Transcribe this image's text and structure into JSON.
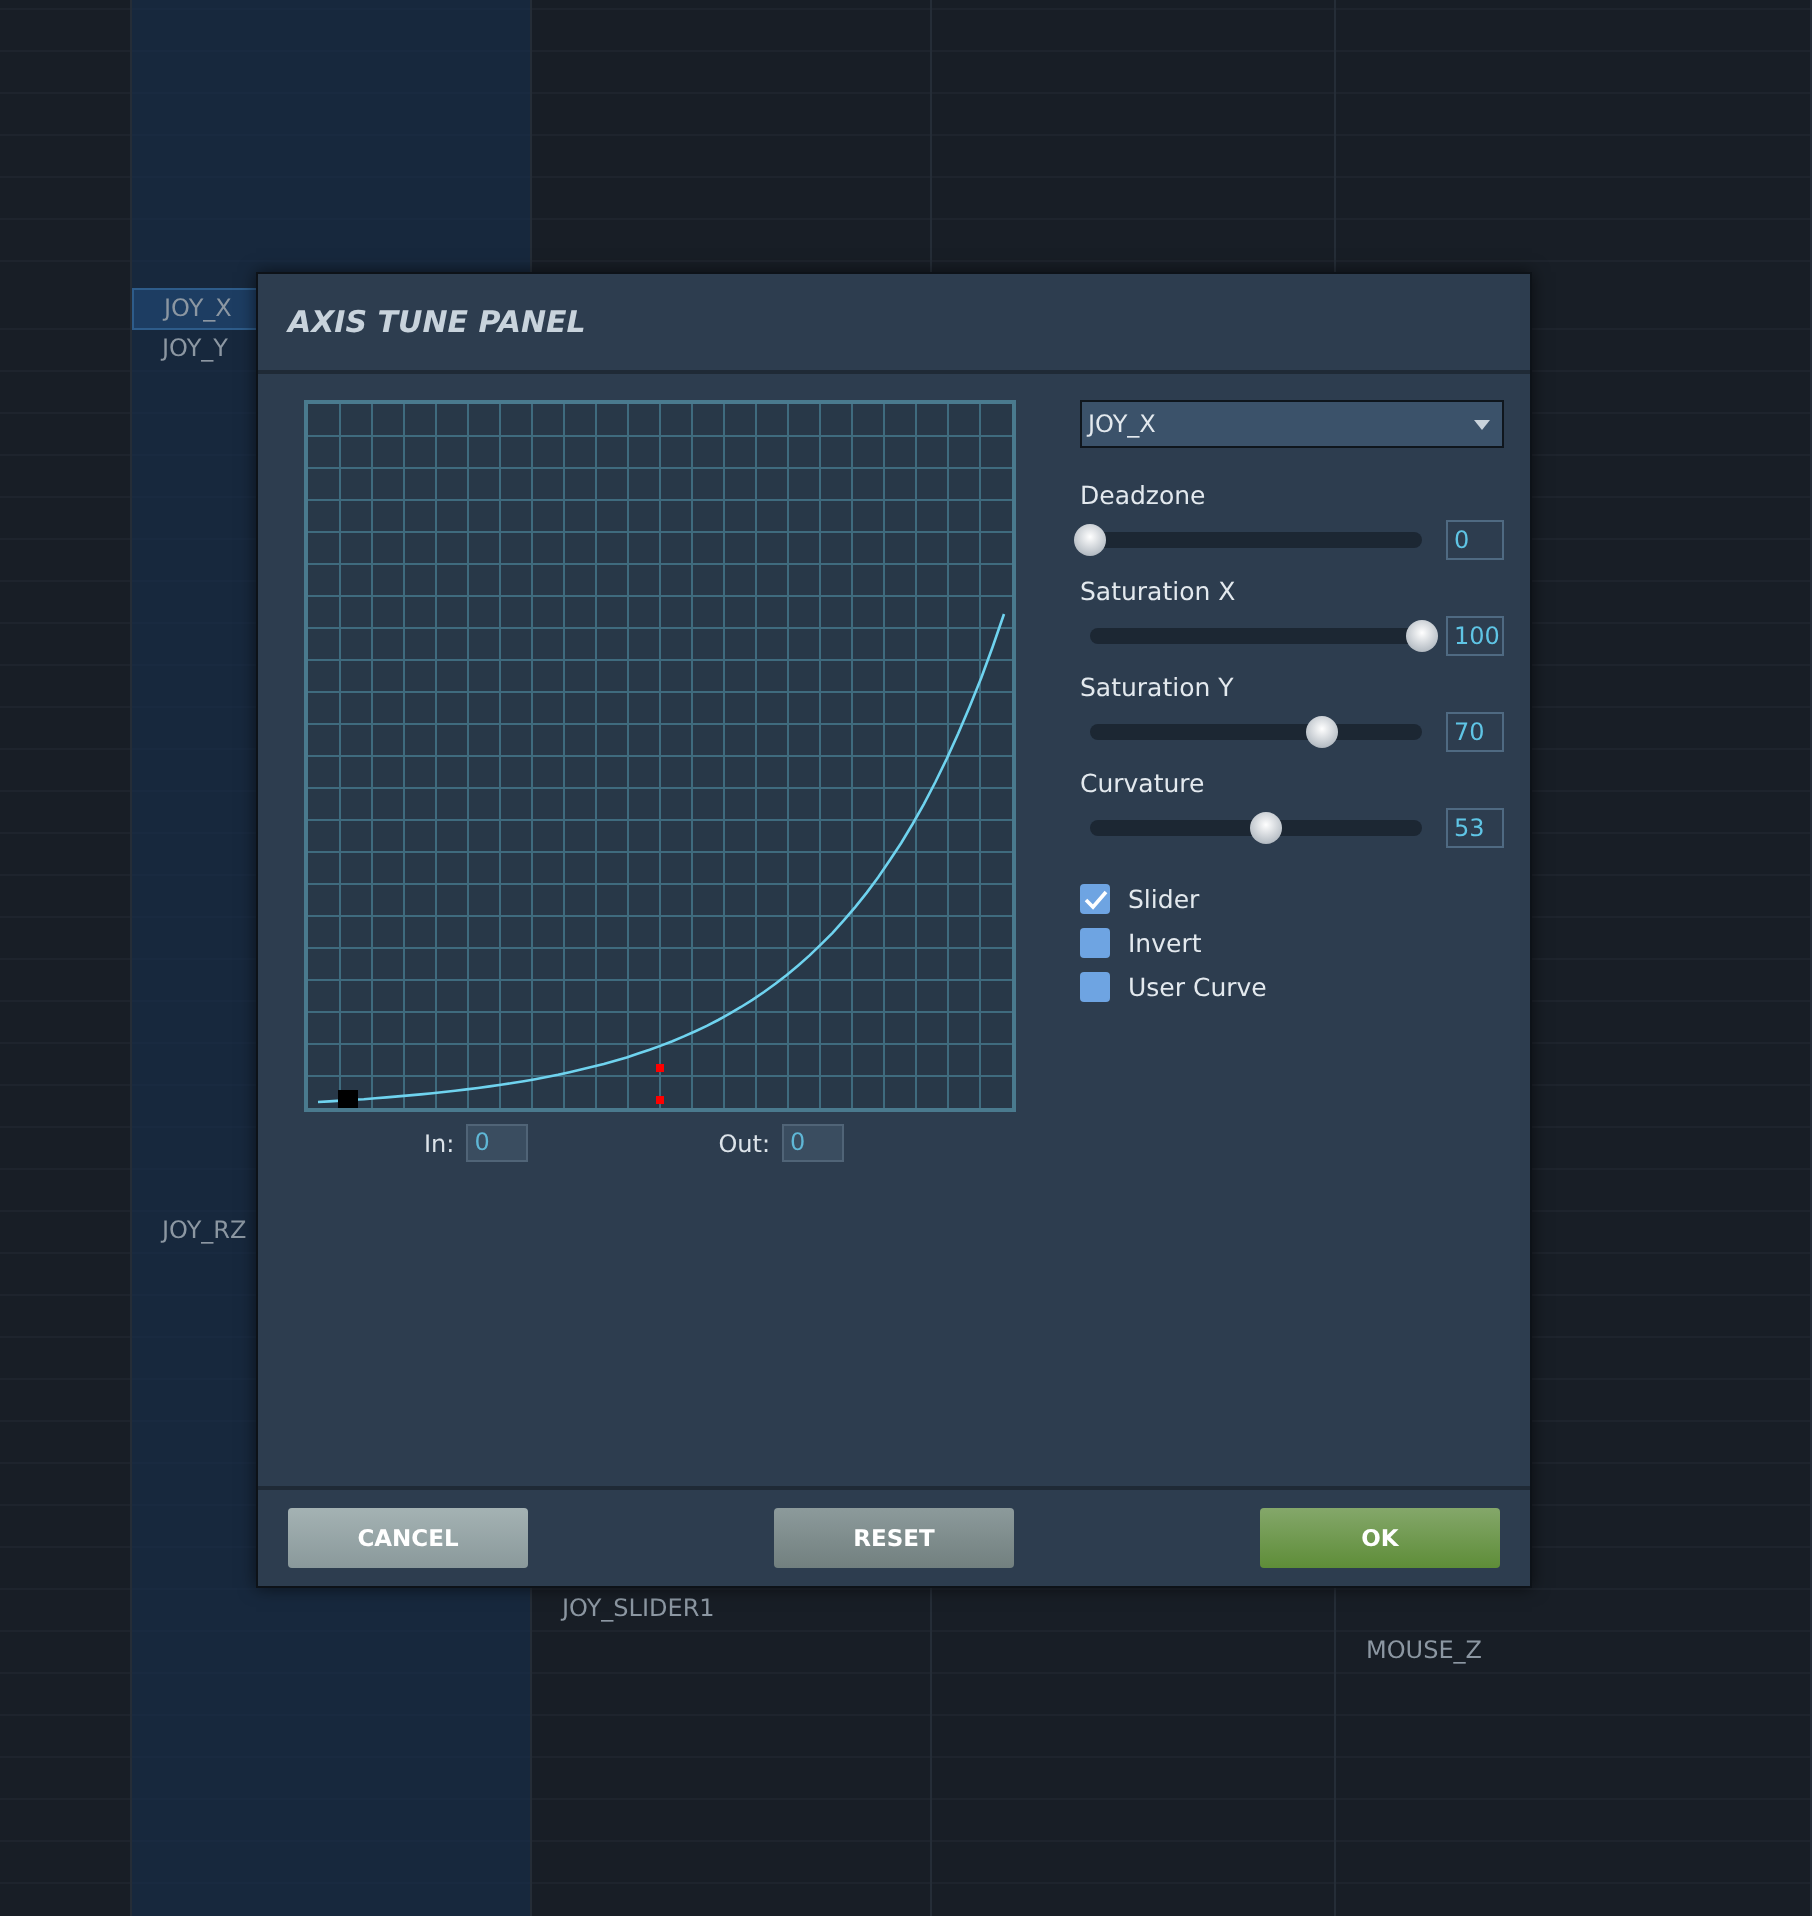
{
  "background_list": [
    {
      "text": "JOY_X",
      "selected": true
    },
    {
      "text": "JOY_Y",
      "selected": false
    },
    {
      "text": "JOY_RZ",
      "selected": false
    },
    {
      "text": "JOY_SLIDER1",
      "selected": false
    },
    {
      "text": "MOUSE_Z",
      "selected": false
    }
  ],
  "dialog": {
    "title": "AXIS TUNE PANEL",
    "readouts": [
      {
        "label": "In:",
        "value": "0"
      },
      {
        "label": "Out:",
        "value": "0"
      }
    ],
    "axis_select": {
      "value": "JOY_X"
    },
    "sliders": [
      {
        "label": "Deadzone",
        "level": 0,
        "value": "0"
      },
      {
        "label": "Saturation X",
        "level": 1,
        "value": "100"
      },
      {
        "label": "Saturation Y",
        "level": 0.7,
        "value": "70"
      },
      {
        "label": "Curvature",
        "level": 0.53,
        "value": "53"
      }
    ],
    "checkboxes": [
      {
        "label": "Slider",
        "checked": true
      },
      {
        "label": "Invert",
        "checked": false
      },
      {
        "label": "User Curve",
        "checked": false
      }
    ],
    "buttons": [
      {
        "label": "CANCEL",
        "kind": "cancel"
      },
      {
        "label": "RESET",
        "kind": "reset"
      },
      {
        "label": "OK",
        "kind": "ok"
      }
    ]
  }
}
